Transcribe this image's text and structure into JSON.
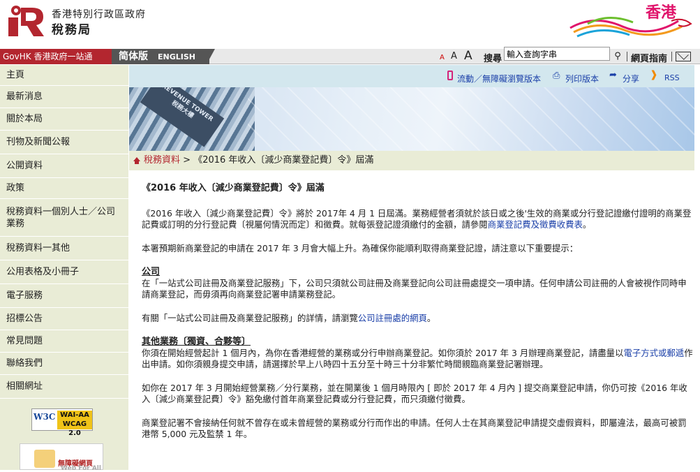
{
  "header": {
    "department_top": "香港特別行政區政府",
    "department": "稅務局",
    "brand": "香港"
  },
  "navbar": {
    "govhk": "GovHK 香港政府一站通",
    "lang_sc": "简体版",
    "lang_en": "ENGLISH",
    "font_small": "A",
    "font_medium": "A",
    "font_large": "A",
    "search_label": "搜尋",
    "search_placeholder": "輸入查詢字串",
    "sitemap": "網頁指南"
  },
  "sidebar": {
    "items": [
      {
        "label": "主頁"
      },
      {
        "label": "最新消息"
      },
      {
        "label": "關於本局"
      },
      {
        "label": "刊物及新聞公報"
      },
      {
        "label": "公開資料"
      },
      {
        "label": "政策"
      },
      {
        "label": "稅務資料一個別人士／公司業務"
      },
      {
        "label": "稅務資料一其他"
      },
      {
        "label": "公用表格及小冊子"
      },
      {
        "label": "電子服務"
      },
      {
        "label": "招標公告"
      },
      {
        "label": "常見問題"
      },
      {
        "label": "聯絡我們"
      },
      {
        "label": "相關網址"
      }
    ],
    "w3c_mark": "W3C",
    "w3c_line1": "WAI-AA",
    "w3c_line2": "WCAG 2.0",
    "wfa_zh": "無障礙網頁",
    "wfa_en": "Web For All"
  },
  "utilities": {
    "mobile": "流動／無障礙瀏覽版本",
    "print": "列印版本",
    "share": "分享",
    "rss": "RSS"
  },
  "banner": {
    "sign_en": "REVENUE TOWER",
    "sign_zh": "稅務大樓"
  },
  "breadcrumb": {
    "home": "稅務資料",
    "separator": ">",
    "current": "《2016 年收入〔減少商業登記費〕令》屆滿"
  },
  "content": {
    "title": "《2016 年收入〔減少商業登記費〕令》屆滿",
    "p1_text": "《2016 年收入〔減少商業登記費〕令》將於 2017年 4 月 1 日屆滿。業務經營者須就於該日或之後'生效的商業或分行登記證繳付證明的商業登記費或訂明的分行登記費〔視屬何情況而定〕和徵費。就每張登記證須繳付的金額，請參閱",
    "p1_link": "商業登記費及徵費收費表",
    "p1_end": "。",
    "p2": "本署預期新商業登記的申請在 2017 年 3 月會大幅上升。為確保你能順利取得商業登記證，請注意以下重要提示：",
    "h_company": "公司",
    "p3": "在「一站式公司註冊及商業登記服務」下，公司只須就公司註冊及商業登記向公司註冊處提交一項申請。任何申請公司註冊的人會被視作同時申請商業登記，而毋須再向商業登記署申請業務登記。",
    "p4_text": "有關「一站式公司註冊及商業登記服務」的詳情，請瀏覽",
    "p4_link": "公司註冊處的網頁",
    "p4_end": "。",
    "h_other": "其他業務〔獨資、合夥等〕",
    "p5_text": "你須在開始經營起計 1 個月內，為你在香港經營的業務或分行申辦商業登記。如你須於 2017 年 3 月辦理商業登記，請盡量以",
    "p5_link": "電子方式或郵遞",
    "p5_end": "作出申請。如你須親身提交申請，請選擇於早上八時四十五分至十時三十分非繁忙時間親臨商業登記署辦理。",
    "p6": "如你在 2017 年 3 月開始經營業務／分行業務，並在開業後 1 個月時限內 [ 即於 2017 年 4 月內 ] 提交商業登記申請，你仍可按《2016 年收入〔減少商業登記費〕令》豁免繳付首年商業登記費或分行登記費，而只須繳付徵費。",
    "p7": "商業登記署不會接納任何就不曾存在或未曾經營的業務或分行而作出的申請。任何人士在其商業登記申請提交虛假資料，即屬違法，最高可被罰港幣 5,000 元及監禁 1 年。"
  },
  "colors": {
    "brand_red": "#b3262f",
    "link_blue": "#1a3fa8",
    "sidebar_bg": "#e9ecd6",
    "utilbar_bg": "#d3e7ee",
    "brand_pink": "#e0146b"
  }
}
